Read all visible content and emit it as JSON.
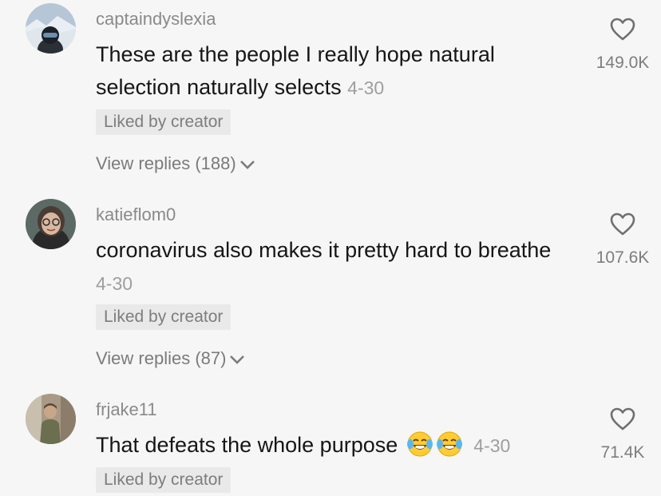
{
  "comments": [
    {
      "username": "captaindyslexia",
      "text": "These are the people I really hope natural selection naturally selects",
      "date": "4-30",
      "liked_by_creator": "Liked by creator",
      "view_replies": "View replies (188)",
      "likes": "149.0K",
      "avatar_icon": "skier-helmet-photo"
    },
    {
      "username": "katieflom0",
      "text": "coronavirus also makes it pretty hard to breathe",
      "date": "4-30",
      "liked_by_creator": "Liked by creator",
      "view_replies": "View replies (87)",
      "likes": "107.6K",
      "avatar_icon": "woman-glasses-photo"
    },
    {
      "username": "frjake11",
      "text": "That defeats the whole purpose",
      "emojis": [
        "tears-of-joy-emoji",
        "tears-of-joy-emoji"
      ],
      "date": "4-30",
      "liked_by_creator": "Liked by creator",
      "likes": "71.4K",
      "avatar_icon": "person-room-photo"
    }
  ],
  "icons": {
    "like": "heart-outline-icon",
    "expand": "chevron-down-icon"
  },
  "colors": {
    "background": "#f6f6f6",
    "text": "#161616",
    "muted": "#8a8a8a",
    "badge": "#e9e9e9"
  }
}
